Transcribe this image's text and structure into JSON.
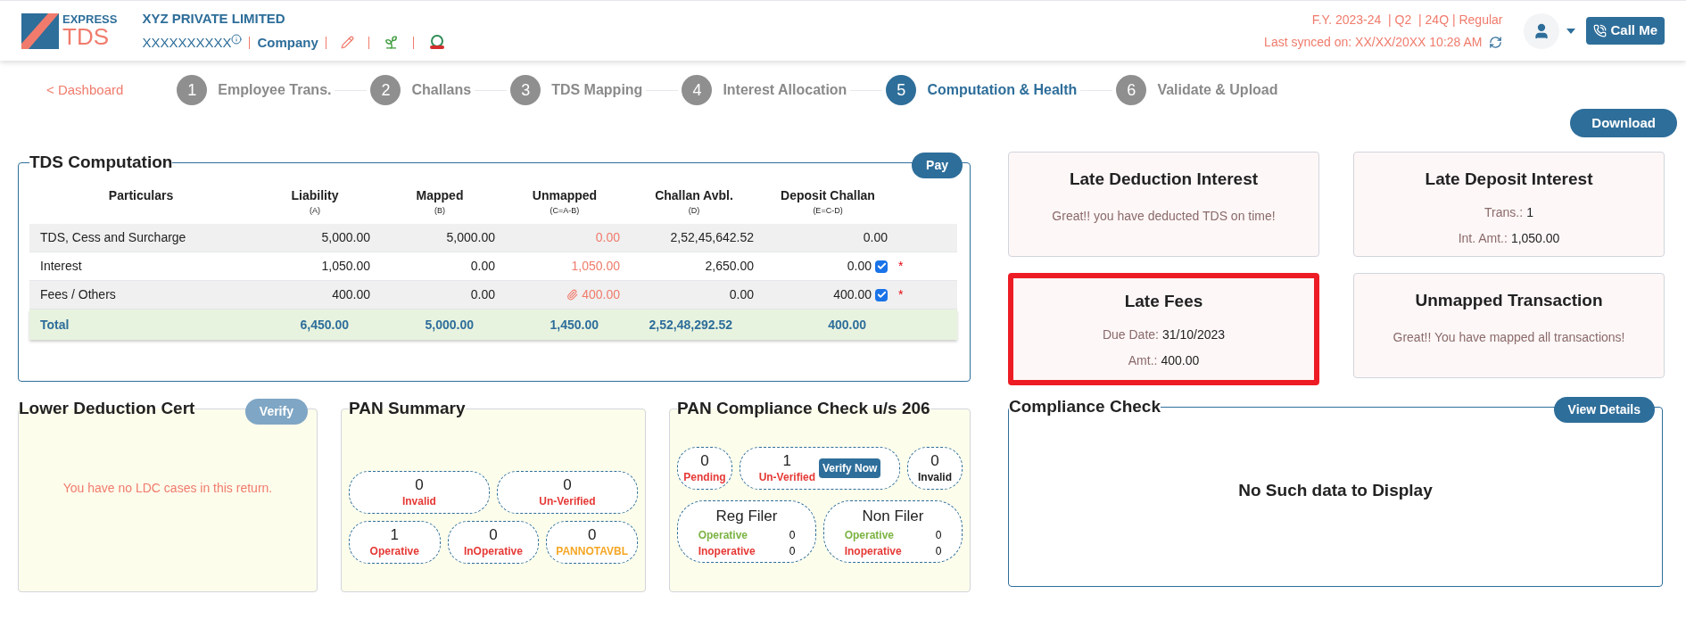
{
  "header": {
    "logo": {
      "top": "EXPRESS",
      "bottom": "TDS"
    },
    "company_name": "XYZ PRIVATE LIMITED",
    "pan": "XXXXXXXXXX",
    "company_type": "Company",
    "return_info": "F.Y. 2023-24  | Q2  | 24Q | Regular",
    "last_synced": "Last synced on: XX/XX/20XX 10:28 AM",
    "call_button": "Call Me"
  },
  "stepper": {
    "back_link": "< Dashboard",
    "steps": [
      {
        "number": "1",
        "label": "Employee Trans.",
        "selected": false
      },
      {
        "number": "2",
        "label": "Challans",
        "selected": false
      },
      {
        "number": "3",
        "label": "TDS Mapping",
        "selected": false
      },
      {
        "number": "4",
        "label": "Interest Allocation",
        "selected": false
      },
      {
        "number": "5",
        "label": "Computation & Health",
        "selected": true
      },
      {
        "number": "6",
        "label": "Validate & Upload",
        "selected": false
      }
    ]
  },
  "download_button": "Download",
  "tds_computation": {
    "title": "TDS Computation",
    "pay_button": "Pay",
    "columns": [
      {
        "label": "Particulars"
      },
      {
        "label": "Liability",
        "sub": "(A)"
      },
      {
        "label": "Mapped",
        "sub": "(B)"
      },
      {
        "label": "Unmapped",
        "sub": "(C=A-B)"
      },
      {
        "label": "Challan Avbl.",
        "sub": "(D)"
      },
      {
        "label": "Deposit Challan",
        "sub": "(E=C-D)"
      }
    ],
    "rows": [
      {
        "particulars": "TDS, Cess and Surcharge",
        "liability": "5,000.00",
        "mapped": "5,000.00",
        "unmapped": "0.00",
        "attachment": false,
        "challan": "2,52,45,642.52",
        "deposit": "0.00"
      },
      {
        "particulars": "Interest",
        "liability": "1,050.00",
        "mapped": "0.00",
        "unmapped": "1,050.00",
        "attachment": false,
        "challan": "2,650.00",
        "deposit": "0.00",
        "checked": true,
        "required_mark": "*"
      },
      {
        "particulars": "Fees / Others",
        "liability": "400.00",
        "mapped": "0.00",
        "unmapped": "400.00",
        "attachment": true,
        "challan": "0.00",
        "deposit": "400.00",
        "checked": true,
        "required_mark": "*"
      }
    ],
    "total": {
      "particulars": "Total",
      "liability": "6,450.00",
      "mapped": "5,000.00",
      "unmapped": "1,450.00",
      "challan": "2,52,48,292.52",
      "deposit": "400.00"
    }
  },
  "health_cards": [
    {
      "title": "Late Deduction Interest",
      "highlighted": false,
      "message": "Great!! you have deducted TDS on time!"
    },
    {
      "title": "Late Deposit Interest",
      "highlighted": false,
      "fields": [
        {
          "label": "Trans.:",
          "value": "1"
        },
        {
          "label": "Int. Amt.:",
          "value": "1,050.00"
        }
      ]
    },
    {
      "title": "Late Fees",
      "highlighted": true,
      "fields": [
        {
          "label": "Due Date:",
          "value": "31/10/2023"
        },
        {
          "label": "Amt.:",
          "value": "400.00"
        }
      ]
    },
    {
      "title": "Unmapped Transaction",
      "highlighted": false,
      "message": "Great!! You have mapped all transactions!"
    }
  ],
  "lower_deduction_cert": {
    "title": "Lower Deduction Cert",
    "verify_button": "Verify",
    "message": "You have no LDC cases in this return."
  },
  "pan_summary": {
    "title": "PAN Summary",
    "items": [
      {
        "value": "0",
        "label": "Invalid",
        "color": "#e53935"
      },
      {
        "value": "0",
        "label": "Un-Verified",
        "color": "#e53935"
      },
      {
        "value": "1",
        "label": "Operative",
        "color": "#e53935"
      },
      {
        "value": "0",
        "label": "InOperative",
        "color": "#e53935"
      },
      {
        "value": "0",
        "label": "PANNOTAVBL",
        "color": "#f5a623"
      }
    ]
  },
  "pan_compliance": {
    "title": "PAN Compliance Check u/s 206",
    "items": [
      {
        "value": "0",
        "label": "Pending",
        "color": "#e53935"
      },
      {
        "value": "1",
        "label": "Un-Verified",
        "color": "#e53935",
        "action": "Verify Now"
      },
      {
        "value": "0",
        "label": "Invalid",
        "color": "#222222"
      }
    ],
    "filers": [
      {
        "title": "Reg Filer",
        "rows": [
          {
            "label": "Operative",
            "value": "0",
            "color": "#7cb342"
          },
          {
            "label": "Inoperative",
            "value": "0",
            "color": "#e53935"
          }
        ]
      },
      {
        "title": "Non Filer",
        "rows": [
          {
            "label": "Operative",
            "value": "0",
            "color": "#7cb342"
          },
          {
            "label": "Inoperative",
            "value": "0",
            "color": "#e53935"
          }
        ]
      }
    ]
  },
  "compliance_check": {
    "title": "Compliance Check",
    "button": "View Details",
    "message": "No Such data to Display"
  }
}
